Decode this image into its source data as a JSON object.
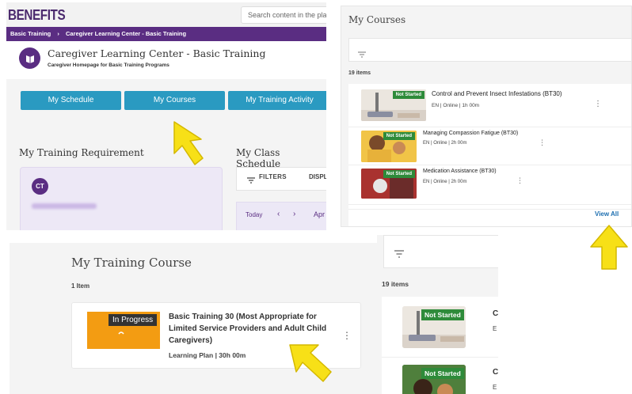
{
  "panel_top_left": {
    "brand": "BENEFITS",
    "search_placeholder": "Search content in the plat",
    "breadcrumb": [
      "Basic Training",
      "›",
      "Caregiver Learning Center - Basic Training"
    ],
    "title": "Caregiver Learning Center - Basic Training",
    "subtitle": "Caregiver Homepage for Basic Training Programs",
    "buttons": [
      "My Schedule",
      "My Courses",
      "My Training Activity"
    ],
    "requirement_heading": "My Training Requirement",
    "schedule_heading": "My Class Schedule",
    "avatar_initials": "CT",
    "filters_label": "FILTERS",
    "display_label": "DISPL",
    "today_label": "Today",
    "prev": "‹",
    "next": "›",
    "month_label": "Apr"
  },
  "panel_top_right": {
    "heading": "My Courses",
    "count": "19 items",
    "items": [
      {
        "title": "Control and Prevent Insect Infestations (BT30)",
        "meta": "EN  |  Online  |  1h 00m",
        "badge": "Not Started"
      },
      {
        "title": "Managing Compassion Fatigue (BT30)",
        "meta": "EN  |  Online  |  2h 00m",
        "badge": "Not Started"
      },
      {
        "title": "Medication Assistance (BT30)",
        "meta": "EN  |  Online  |  2h 00m",
        "badge": "Not Started"
      }
    ],
    "view_all": "View All"
  },
  "panel_bottom_left": {
    "heading": "My Training Course",
    "count": "1 Item",
    "course": {
      "badge": "In Progress",
      "title": "Basic Training 30 (Most Appropriate for Limited Service Providers and Adult Child Caregivers)",
      "meta": "Learning Plan  |  30h 00m"
    }
  },
  "panel_bottom_right": {
    "count": "19 items",
    "badges": [
      "Not Started",
      "Not Started"
    ],
    "truncated_titles": [
      "C",
      "C"
    ],
    "truncated_meta": [
      "E",
      "E"
    ]
  },
  "colors": {
    "brand_purple": "#5a2d82",
    "button_blue": "#2a9ac1",
    "not_started_green": "#2e8b3a",
    "in_progress_orange": "#f39c12",
    "arrow_yellow": "#f7e017"
  },
  "icons": [
    "filter-icon",
    "kebab-icon",
    "arrow-pointer-icon",
    "logo-icon"
  ]
}
